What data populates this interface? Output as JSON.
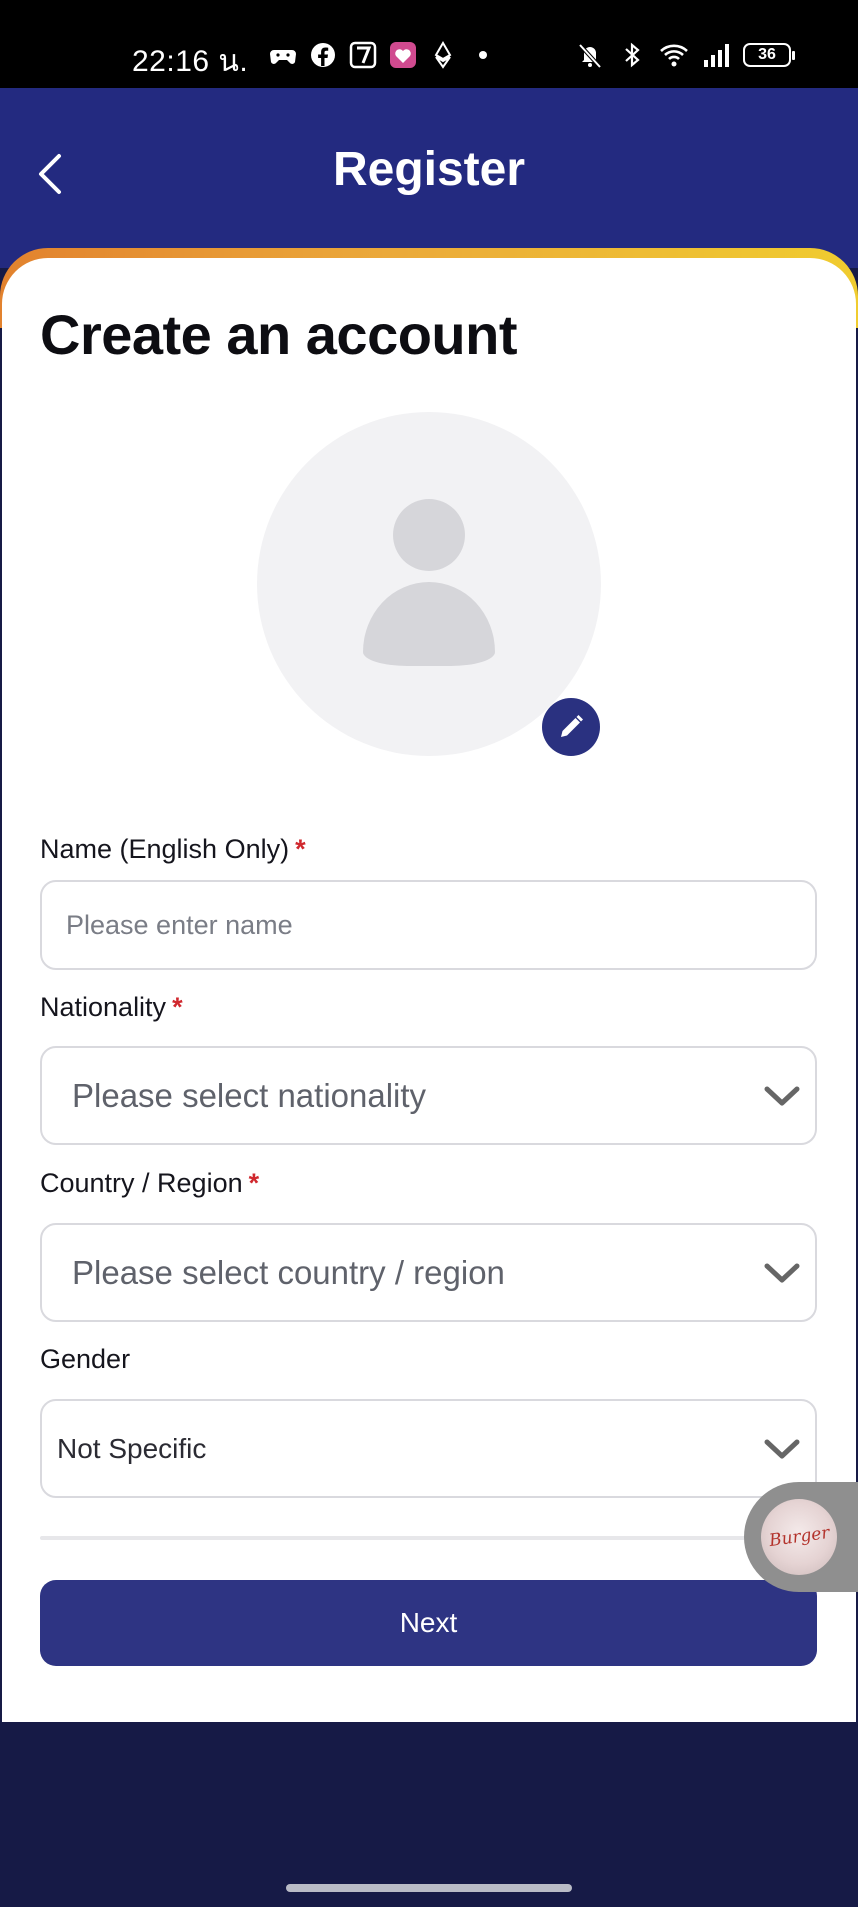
{
  "status_bar": {
    "time": "22:16 น.",
    "battery": "36"
  },
  "header": {
    "title": "Register"
  },
  "page": {
    "title": "Create an account"
  },
  "form": {
    "name": {
      "label": "Name (English Only)",
      "required_mark": "*",
      "placeholder": "Please enter name"
    },
    "nationality": {
      "label": "Nationality",
      "required_mark": "*",
      "placeholder": "Please select nationality"
    },
    "country": {
      "label": "Country / Region",
      "required_mark": "*",
      "placeholder": "Please select country / region"
    },
    "gender": {
      "label": "Gender",
      "value": "Not Specific"
    },
    "next_label": "Next"
  },
  "floating_widget": {
    "text": "Burger"
  },
  "colors": {
    "header_bg": "#232a80",
    "button_bg": "#2e3483",
    "accent_start": "#e2822e",
    "accent_end": "#f0cc2f",
    "required": "#d0282e",
    "bottom_bg": "#161a46"
  }
}
